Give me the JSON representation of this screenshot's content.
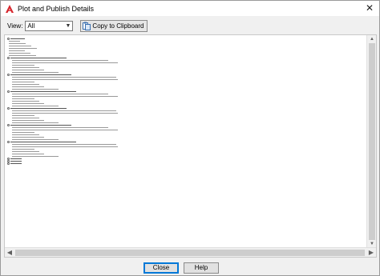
{
  "window": {
    "title": "Plot and Publish Details",
    "close_glyph": "✕"
  },
  "toolbar": {
    "view_label": "View:",
    "view_value": "All",
    "copy_label": "Copy to Clipboard"
  },
  "footer": {
    "close_label": "Close",
    "help_label": "Help"
  },
  "colors": {
    "accent": "#0078d7",
    "app_icon": "#d6252c"
  },
  "icons": [
    "autocad-app-icon",
    "close-icon",
    "clipboard-icon",
    "chevron-down-icon"
  ]
}
